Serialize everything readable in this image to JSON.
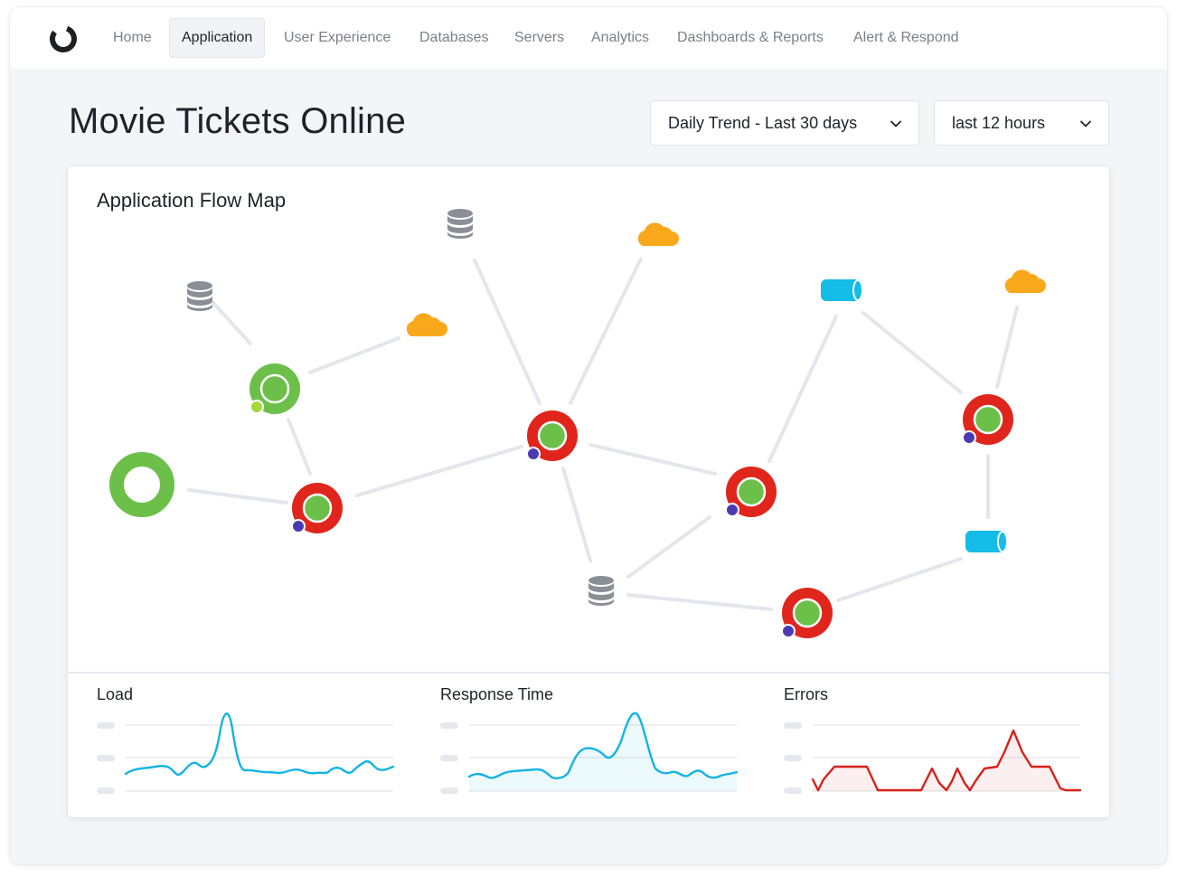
{
  "nav": {
    "logo_icon": "ring-logo-icon",
    "items": [
      {
        "label": "Home",
        "active": false
      },
      {
        "label": "Application",
        "active": true
      },
      {
        "label": "User Experience",
        "active": false
      },
      {
        "label": "Databases",
        "active": false
      },
      {
        "label": "Servers",
        "active": false
      },
      {
        "label": "Analytics",
        "active": false
      },
      {
        "label": "Dashboards & Reports",
        "active": false
      },
      {
        "label": "Alert & Respond",
        "active": false
      }
    ]
  },
  "page": {
    "title": "Movie Tickets Online",
    "trend_select": {
      "value": "Daily Trend - Last 30 days",
      "icon": "chevron-down-icon"
    },
    "range_select": {
      "value": "last 12 hours",
      "icon": "chevron-down-icon"
    }
  },
  "flow_map": {
    "title": "Application Flow Map",
    "colors": {
      "healthy": "#6cc04a",
      "critical": "#e0261c",
      "database": "#8a8f96",
      "cloud": "#f9a81b",
      "queue": "#13bde8",
      "link": "#e4e6ec",
      "badge": "#4b3bb0"
    }
  },
  "metrics": {
    "load": {
      "title": "Load",
      "color": "#13b3e6"
    },
    "response_time": {
      "title": "Response Time",
      "color": "#13b3e6"
    },
    "errors": {
      "title": "Errors",
      "color": "#d7221a"
    }
  }
}
